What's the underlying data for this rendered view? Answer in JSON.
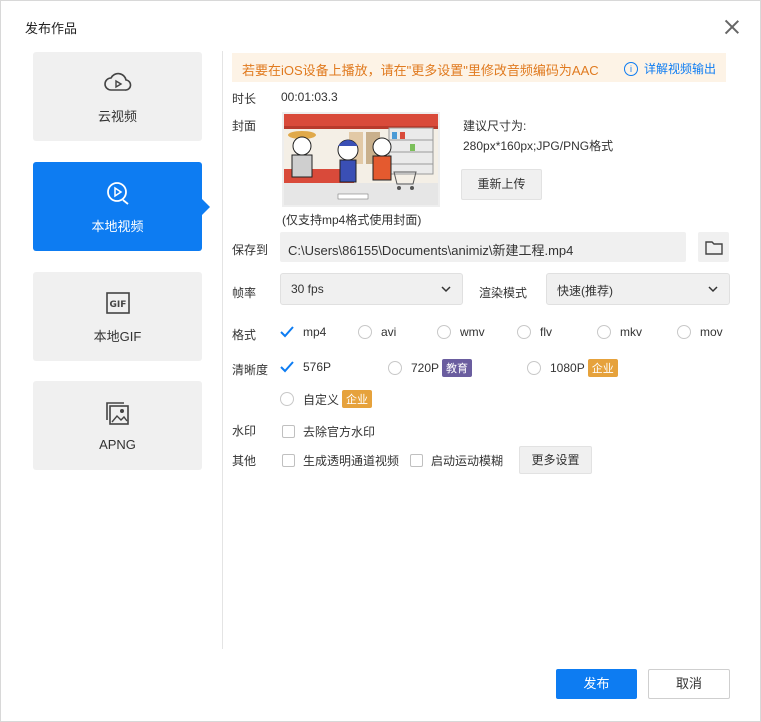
{
  "dialog": {
    "title": "发布作品"
  },
  "sidebar": {
    "items": [
      {
        "label": "云视频",
        "icon": "cloud-play-icon"
      },
      {
        "label": "本地视频",
        "icon": "video-play-icon"
      },
      {
        "label": "本地GIF",
        "icon": "gif-icon"
      },
      {
        "label": "APNG",
        "icon": "image-icon"
      }
    ],
    "active_index": 1
  },
  "notice": {
    "text": "若要在iOS设备上播放，请在\"更多设置\"里修改音频编码为AAC",
    "link": "详解视频输出"
  },
  "duration": {
    "label": "时长",
    "value": "00:01:03.3"
  },
  "cover": {
    "label": "封面",
    "hint_title": "建议尺寸为:",
    "hint_size": "280px*160px;JPG/PNG格式",
    "reupload": "重新上传",
    "note": "(仅支持mp4格式使用封面)"
  },
  "save_to": {
    "label": "保存到",
    "path": "C:\\Users\\86155\\Documents\\animiz\\新建工程.mp4"
  },
  "framerate": {
    "label": "帧率",
    "value": "30 fps"
  },
  "render_mode": {
    "label": "渲染模式",
    "value": "快速(推荐)"
  },
  "format": {
    "label": "格式",
    "options": [
      "mp4",
      "avi",
      "wmv",
      "flv",
      "mkv",
      "mov"
    ],
    "selected": "mp4"
  },
  "resolution": {
    "label": "清晰度",
    "options": [
      {
        "label": "576P",
        "badge": ""
      },
      {
        "label": "720P",
        "badge": "教育"
      },
      {
        "label": "1080P",
        "badge": "企业"
      },
      {
        "label": "自定义",
        "badge": "企业"
      }
    ],
    "selected": "576P"
  },
  "watermark": {
    "label": "水印",
    "option": "去除官方水印"
  },
  "other": {
    "label": "其他",
    "opt1": "生成透明通道视频",
    "opt2": "启动运动模糊",
    "more": "更多设置"
  },
  "footer": {
    "publish": "发布",
    "cancel": "取消"
  },
  "colors": {
    "accent": "#0d7cf2",
    "notice_text": "#e07a1f",
    "badge_edu": "#6a5d9f",
    "badge_ent": "#e6a23c"
  }
}
